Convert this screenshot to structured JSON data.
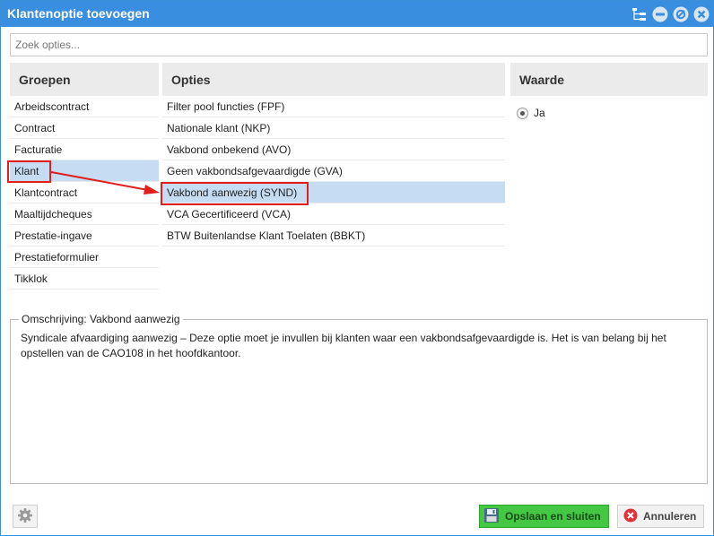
{
  "window": {
    "title": "Klantenoptie toevoegen",
    "accent_color": "#3a8ee0",
    "titlebar_icons": [
      "tree-icon",
      "minimize-icon",
      "restore-icon",
      "close-icon"
    ]
  },
  "search": {
    "placeholder": "Zoek opties...",
    "value": ""
  },
  "groups": {
    "header": "Groepen",
    "selected_index": 3,
    "items": [
      "Arbeidscontract",
      "Contract",
      "Facturatie",
      "Klant",
      "Klantcontract",
      "Maaltijdcheques",
      "Prestatie-ingave",
      "Prestatieformulier",
      "Tikklok"
    ]
  },
  "options": {
    "header": "Opties",
    "selected_index": 4,
    "items": [
      "Filter pool functies (FPF)",
      "Nationale klant (NKP)",
      "Vakbond onbekend (AVO)",
      "Geen vakbondsafgevaardigde (GVA)",
      "Vakbond aanwezig (SYND)",
      "VCA Gecertificeerd (VCA)",
      "BTW Buitenlandse Klant Toelaten (BBKT)"
    ]
  },
  "value": {
    "header": "Waarde",
    "radio_label": "Ja",
    "radio_selected": true
  },
  "description": {
    "legend": "Omschrijving: Vakbond aanwezig",
    "text": "Syndicale afvaardiging aanwezig – Deze optie moet je invullen bij klanten waar een vakbondsafgevaardigde is. Het is van belang bij het opstellen van de CAO108 in het hoofdkantoor."
  },
  "footer": {
    "settings_icon": "gear-icon",
    "save_label": "Opslaan en sluiten",
    "save_icon": "floppy-disk-icon",
    "save_color": "#44c844",
    "cancel_label": "Annuleren",
    "cancel_icon": "cancel-icon",
    "cancel_icon_color": "#e0303a"
  },
  "annotation": {
    "highlight_color": "#e01e1e"
  }
}
